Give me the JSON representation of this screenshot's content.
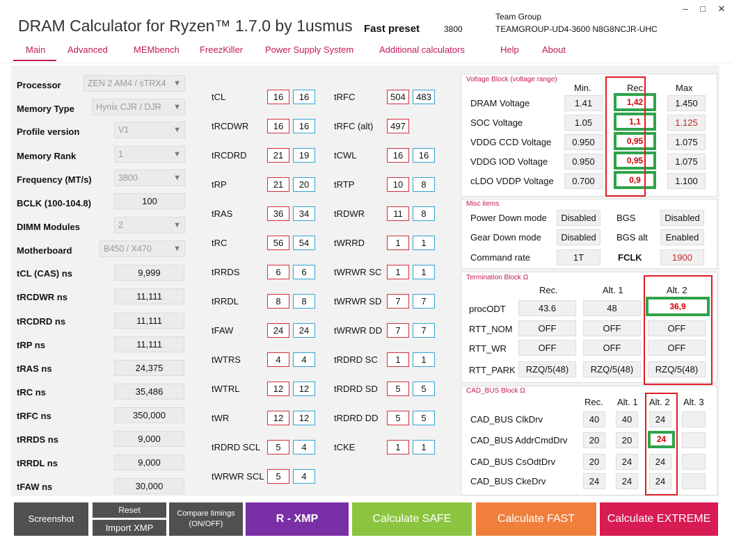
{
  "window": {
    "title": "DRAM Calculator for Ryzen™ 1.7.0 by 1usmus",
    "preset_label": "Fast preset",
    "preset_value": "3800",
    "vendor": "Team Group",
    "part_number": "TEAMGROUP-UD4-3600 N8G8NCJR-UHC",
    "min_icon": "minimize-icon",
    "max_icon": "maximize-icon",
    "close_icon": "close-icon"
  },
  "tabs": [
    "Main",
    "Advanced",
    "MEMbench",
    "FreezKiller",
    "Power Supply System",
    "Additional calculators",
    "Help",
    "About"
  ],
  "settings": [
    {
      "label": "Processor",
      "value": "ZEN 2 AM4 / sTRX4",
      "dropdown": true
    },
    {
      "label": "Memory Type",
      "value": "Hynix CJR / DJR",
      "dropdown": true
    },
    {
      "label": "Profile version",
      "value": "V1",
      "dropdown": true
    },
    {
      "label": "Memory Rank",
      "value": "1",
      "dropdown": true
    },
    {
      "label": "Frequency (MT/s)",
      "value": "3800",
      "dropdown": true
    },
    {
      "label": "BCLK (100-104.8)",
      "value": "100",
      "dropdown": false
    },
    {
      "label": "DIMM Modules",
      "value": "2",
      "dropdown": true
    },
    {
      "label": "Motherboard",
      "value": "B450 / X470",
      "dropdown": true
    }
  ],
  "ns_values": [
    {
      "label": "tCL (CAS) ns",
      "value": "9,999"
    },
    {
      "label": "tRCDWR ns",
      "value": "11,111"
    },
    {
      "label": "tRCDRD ns",
      "value": "11,111"
    },
    {
      "label": "tRP ns",
      "value": "11,111"
    },
    {
      "label": "tRAS ns",
      "value": "24,375"
    },
    {
      "label": "tRC ns",
      "value": "35,486"
    },
    {
      "label": "tRFC ns",
      "value": "350,000"
    },
    {
      "label": "tRRDS ns",
      "value": "9,000"
    },
    {
      "label": "tRRDL ns",
      "value": "9,000"
    },
    {
      "label": "tFAW ns",
      "value": "30,000"
    }
  ],
  "timings_left": [
    {
      "label": "tCL",
      "a": "16",
      "b": "16"
    },
    {
      "label": "tRCDWR",
      "a": "16",
      "b": "16"
    },
    {
      "label": "tRCDRD",
      "a": "21",
      "b": "19"
    },
    {
      "label": "tRP",
      "a": "21",
      "b": "20"
    },
    {
      "label": "tRAS",
      "a": "36",
      "b": "34"
    },
    {
      "label": "tRC",
      "a": "56",
      "b": "54"
    },
    {
      "label": "tRRDS",
      "a": "6",
      "b": "6"
    },
    {
      "label": "tRRDL",
      "a": "8",
      "b": "8"
    },
    {
      "label": "tFAW",
      "a": "24",
      "b": "24"
    },
    {
      "label": "tWTRS",
      "a": "4",
      "b": "4"
    },
    {
      "label": "tWTRL",
      "a": "12",
      "b": "12"
    },
    {
      "label": "tWR",
      "a": "12",
      "b": "12"
    },
    {
      "label": "tRDRD SCL",
      "a": "5",
      "b": "4"
    },
    {
      "label": "tWRWR SCL",
      "a": "5",
      "b": "4"
    }
  ],
  "timings_right": [
    {
      "label": "tRFC",
      "a": "504",
      "b": "483"
    },
    {
      "label": "tRFC (alt)",
      "a": "497",
      "b": ""
    },
    {
      "label": "tCWL",
      "a": "16",
      "b": "16"
    },
    {
      "label": "tRTP",
      "a": "10",
      "b": "8"
    },
    {
      "label": "tRDWR",
      "a": "11",
      "b": "8"
    },
    {
      "label": "tWRRD",
      "a": "1",
      "b": "1"
    },
    {
      "label": "tWRWR SC",
      "a": "1",
      "b": "1"
    },
    {
      "label": "tWRWR SD",
      "a": "7",
      "b": "7"
    },
    {
      "label": "tWRWR DD",
      "a": "7",
      "b": "7"
    },
    {
      "label": "tRDRD SC",
      "a": "1",
      "b": "1"
    },
    {
      "label": "tRDRD SD",
      "a": "5",
      "b": "5"
    },
    {
      "label": "tRDRD DD",
      "a": "5",
      "b": "5"
    },
    {
      "label": "tCKE",
      "a": "1",
      "b": "1"
    }
  ],
  "voltage": {
    "title": "Voltage Block (voltage range)",
    "headers": [
      "Min.",
      "Rec.",
      "Max"
    ],
    "rows": [
      {
        "label": "DRAM Voltage",
        "min": "1.41",
        "rec": "1,42",
        "max": "1.450",
        "max_red": false
      },
      {
        "label": "SOC Voltage",
        "min": "1.05",
        "rec": "1,1",
        "max": "1.125",
        "max_red": true
      },
      {
        "label": "VDDG  CCD Voltage",
        "min": "0.950",
        "rec": "0,95",
        "max": "1.075",
        "max_red": false
      },
      {
        "label": "VDDG  IOD Voltage",
        "min": "0.950",
        "rec": "0,95",
        "max": "1.075",
        "max_red": false
      },
      {
        "label": "cLDO VDDP Voltage",
        "min": "0.700",
        "rec": "0,9",
        "max": "1.100",
        "max_red": false
      }
    ]
  },
  "misc": {
    "title": "Misc items",
    "power_down_label": "Power Down mode",
    "power_down": "Disabled",
    "gear_down_label": "Gear Down mode",
    "gear_down": "Disabled",
    "command_rate_label": "Command rate",
    "command_rate": "1T",
    "bgs_label": "BGS",
    "bgs": "Disabled",
    "bgs_alt_label": "BGS alt",
    "bgs_alt": "Enabled",
    "fclk_label": "FCLK",
    "fclk": "1900"
  },
  "termination": {
    "title": "Termination Block Ω",
    "headers": [
      "Rec.",
      "Alt. 1",
      "Alt. 2"
    ],
    "rows": [
      {
        "label": "procODT",
        "rec": "43.6",
        "alt1": "48",
        "alt2": "36,9"
      },
      {
        "label": "RTT_NOM",
        "rec": "OFF",
        "alt1": "OFF",
        "alt2": "OFF"
      },
      {
        "label": "RTT_WR",
        "rec": "OFF",
        "alt1": "OFF",
        "alt2": "OFF"
      },
      {
        "label": "RTT_PARK",
        "rec": "RZQ/5(48)",
        "alt1": "RZQ/5(48)",
        "alt2": "RZQ/5(48)"
      }
    ]
  },
  "cadbus": {
    "title": "CAD_BUS Block Ω",
    "headers": [
      "Rec.",
      "Alt. 1",
      "Alt. 2",
      "Alt. 3"
    ],
    "rows": [
      {
        "label": "CAD_BUS ClkDrv",
        "rec": "40",
        "alt1": "40",
        "alt2": "24",
        "alt3": ""
      },
      {
        "label": "CAD_BUS AddrCmdDrv",
        "rec": "20",
        "alt1": "20",
        "alt2": "24",
        "alt3": ""
      },
      {
        "label": "CAD_BUS CsOdtDrv",
        "rec": "20",
        "alt1": "24",
        "alt2": "24",
        "alt3": ""
      },
      {
        "label": "CAD_BUS CkeDrv",
        "rec": "24",
        "alt1": "24",
        "alt2": "24",
        "alt3": ""
      }
    ]
  },
  "buttons": {
    "screenshot": "Screenshot",
    "reset": "Reset",
    "import_xmp": "Import XMP",
    "compare_line1": "Compare timings",
    "compare_line2": "(ON/OFF)",
    "rxmp": "R - XMP",
    "safe": "Calculate SAFE",
    "fast": "Calculate FAST",
    "extreme": "Calculate EXTREME"
  },
  "colors": {
    "accent": "#c2185b",
    "rxmp": "#7b2fa6",
    "safe": "#8bc53f",
    "fast": "#f07f3c",
    "extreme": "#d81b52",
    "dark": "#505050"
  }
}
